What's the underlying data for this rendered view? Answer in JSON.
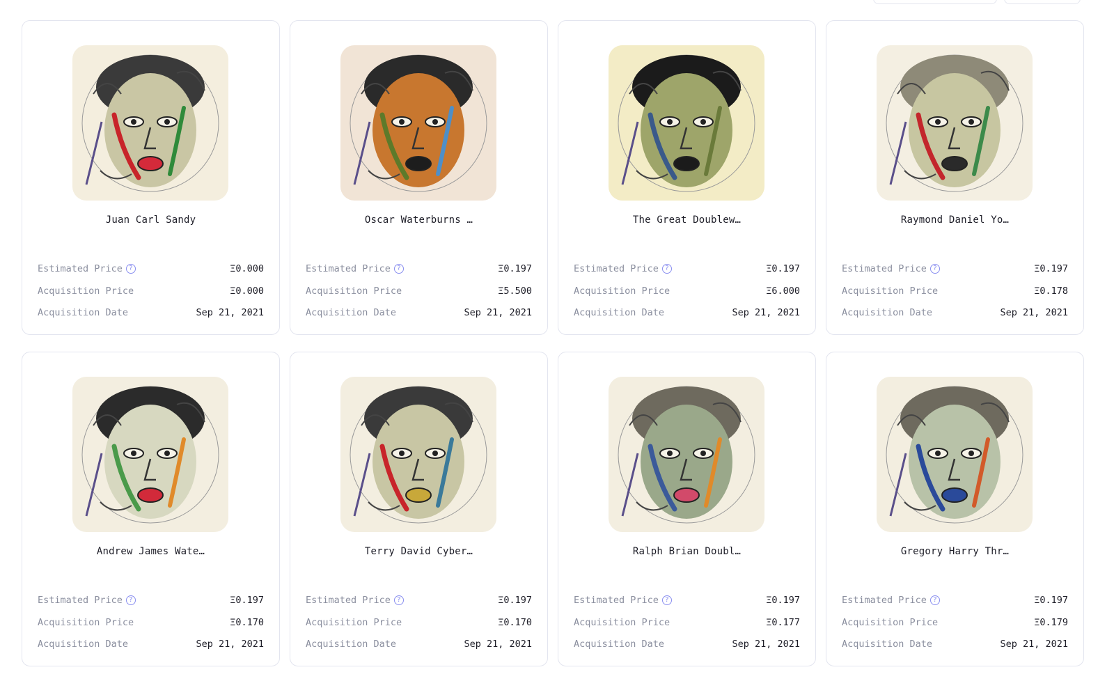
{
  "cards": [
    {
      "name": "Juan Carl Sandy",
      "estimated_label": "Estimated Price",
      "estimated_value": "Ξ0.000",
      "acq_price_label": "Acquisition Price",
      "acq_price_value": "Ξ0.000",
      "acq_date_label": "Acquisition Date",
      "acq_date_value": "Sep 21, 2021",
      "help_icon": "?",
      "art": {
        "bg": "#f4eede",
        "skin": "#c9c6a4",
        "hair": "#3a3a3a",
        "accent": "#c8242a",
        "accent2": "#2f8a3a",
        "mouth": "#d42a3a"
      }
    },
    {
      "name": "Oscar Waterburns …",
      "estimated_label": "Estimated Price",
      "estimated_value": "Ξ0.197",
      "acq_price_label": "Acquisition Price",
      "acq_price_value": "Ξ5.500",
      "acq_date_label": "Acquisition Date",
      "acq_date_value": "Sep 21, 2021",
      "help_icon": "?",
      "art": {
        "bg": "#f1e4d6",
        "skin": "#c8772f",
        "hair": "#2a2a2a",
        "accent": "#5d7a2a",
        "accent2": "#4e8fc8",
        "mouth": "#1d1d1d"
      }
    },
    {
      "name": "The Great Doublew…",
      "estimated_label": "Estimated Price",
      "estimated_value": "Ξ0.197",
      "acq_price_label": "Acquisition Price",
      "acq_price_value": "Ξ6.000",
      "acq_date_label": "Acquisition Date",
      "acq_date_value": "Sep 21, 2021",
      "help_icon": "?",
      "art": {
        "bg": "#f3ecc6",
        "skin": "#9ea56a",
        "hair": "#1b1b1b",
        "accent": "#3a5a8a",
        "accent2": "#6a7a3a",
        "mouth": "#1b1b1b"
      }
    },
    {
      "name": "Raymond Daniel Yo…",
      "estimated_label": "Estimated Price",
      "estimated_value": "Ξ0.197",
      "acq_price_label": "Acquisition Price",
      "acq_price_value": "Ξ0.178",
      "acq_date_label": "Acquisition Date",
      "acq_date_value": "Sep 21, 2021",
      "help_icon": "?",
      "art": {
        "bg": "#f4efe2",
        "skin": "#c7c6a1",
        "hair": "#8e8a78",
        "accent": "#c3262c",
        "accent2": "#3c8a4a",
        "mouth": "#2a2a2a"
      }
    },
    {
      "name": "Andrew James Wate…",
      "estimated_label": "Estimated Price",
      "estimated_value": "Ξ0.197",
      "acq_price_label": "Acquisition Price",
      "acq_price_value": "Ξ0.170",
      "acq_date_label": "Acquisition Date",
      "acq_date_value": "Sep 21, 2021",
      "help_icon": "?",
      "art": {
        "bg": "#f3eee0",
        "skin": "#d7d8c0",
        "hair": "#2b2b2b",
        "accent": "#4a9a4a",
        "accent2": "#e08a2a",
        "mouth": "#d22a3a"
      }
    },
    {
      "name": "Terry David Cyber…",
      "estimated_label": "Estimated Price",
      "estimated_value": "Ξ0.197",
      "acq_price_label": "Acquisition Price",
      "acq_price_value": "Ξ0.170",
      "acq_date_label": "Acquisition Date",
      "acq_date_value": "Sep 21, 2021",
      "help_icon": "?",
      "art": {
        "bg": "#f3eee0",
        "skin": "#c8c6a4",
        "hair": "#3a3a3a",
        "accent": "#c8242a",
        "accent2": "#3a7a9a",
        "mouth": "#c8a83a"
      }
    },
    {
      "name": "Ralph Brian Doubl…",
      "estimated_label": "Estimated Price",
      "estimated_value": "Ξ0.197",
      "acq_price_label": "Acquisition Price",
      "acq_price_value": "Ξ0.177",
      "acq_date_label": "Acquisition Date",
      "acq_date_value": "Sep 21, 2021",
      "help_icon": "?",
      "art": {
        "bg": "#f3eee0",
        "skin": "#9aa88a",
        "hair": "#6e6a5e",
        "accent": "#3b5a9a",
        "accent2": "#e08a2a",
        "mouth": "#d24a6a"
      }
    },
    {
      "name": "Gregory Harry Thr…",
      "estimated_label": "Estimated Price",
      "estimated_value": "Ξ0.197",
      "acq_price_label": "Acquisition Price",
      "acq_price_value": "Ξ0.179",
      "acq_date_label": "Acquisition Date",
      "acq_date_value": "Sep 21, 2021",
      "help_icon": "?",
      "art": {
        "bg": "#f3eee0",
        "skin": "#b8c2a8",
        "hair": "#6e6a5e",
        "accent": "#2a4a9a",
        "accent2": "#d25a2a",
        "mouth": "#2a4a9a"
      }
    }
  ]
}
